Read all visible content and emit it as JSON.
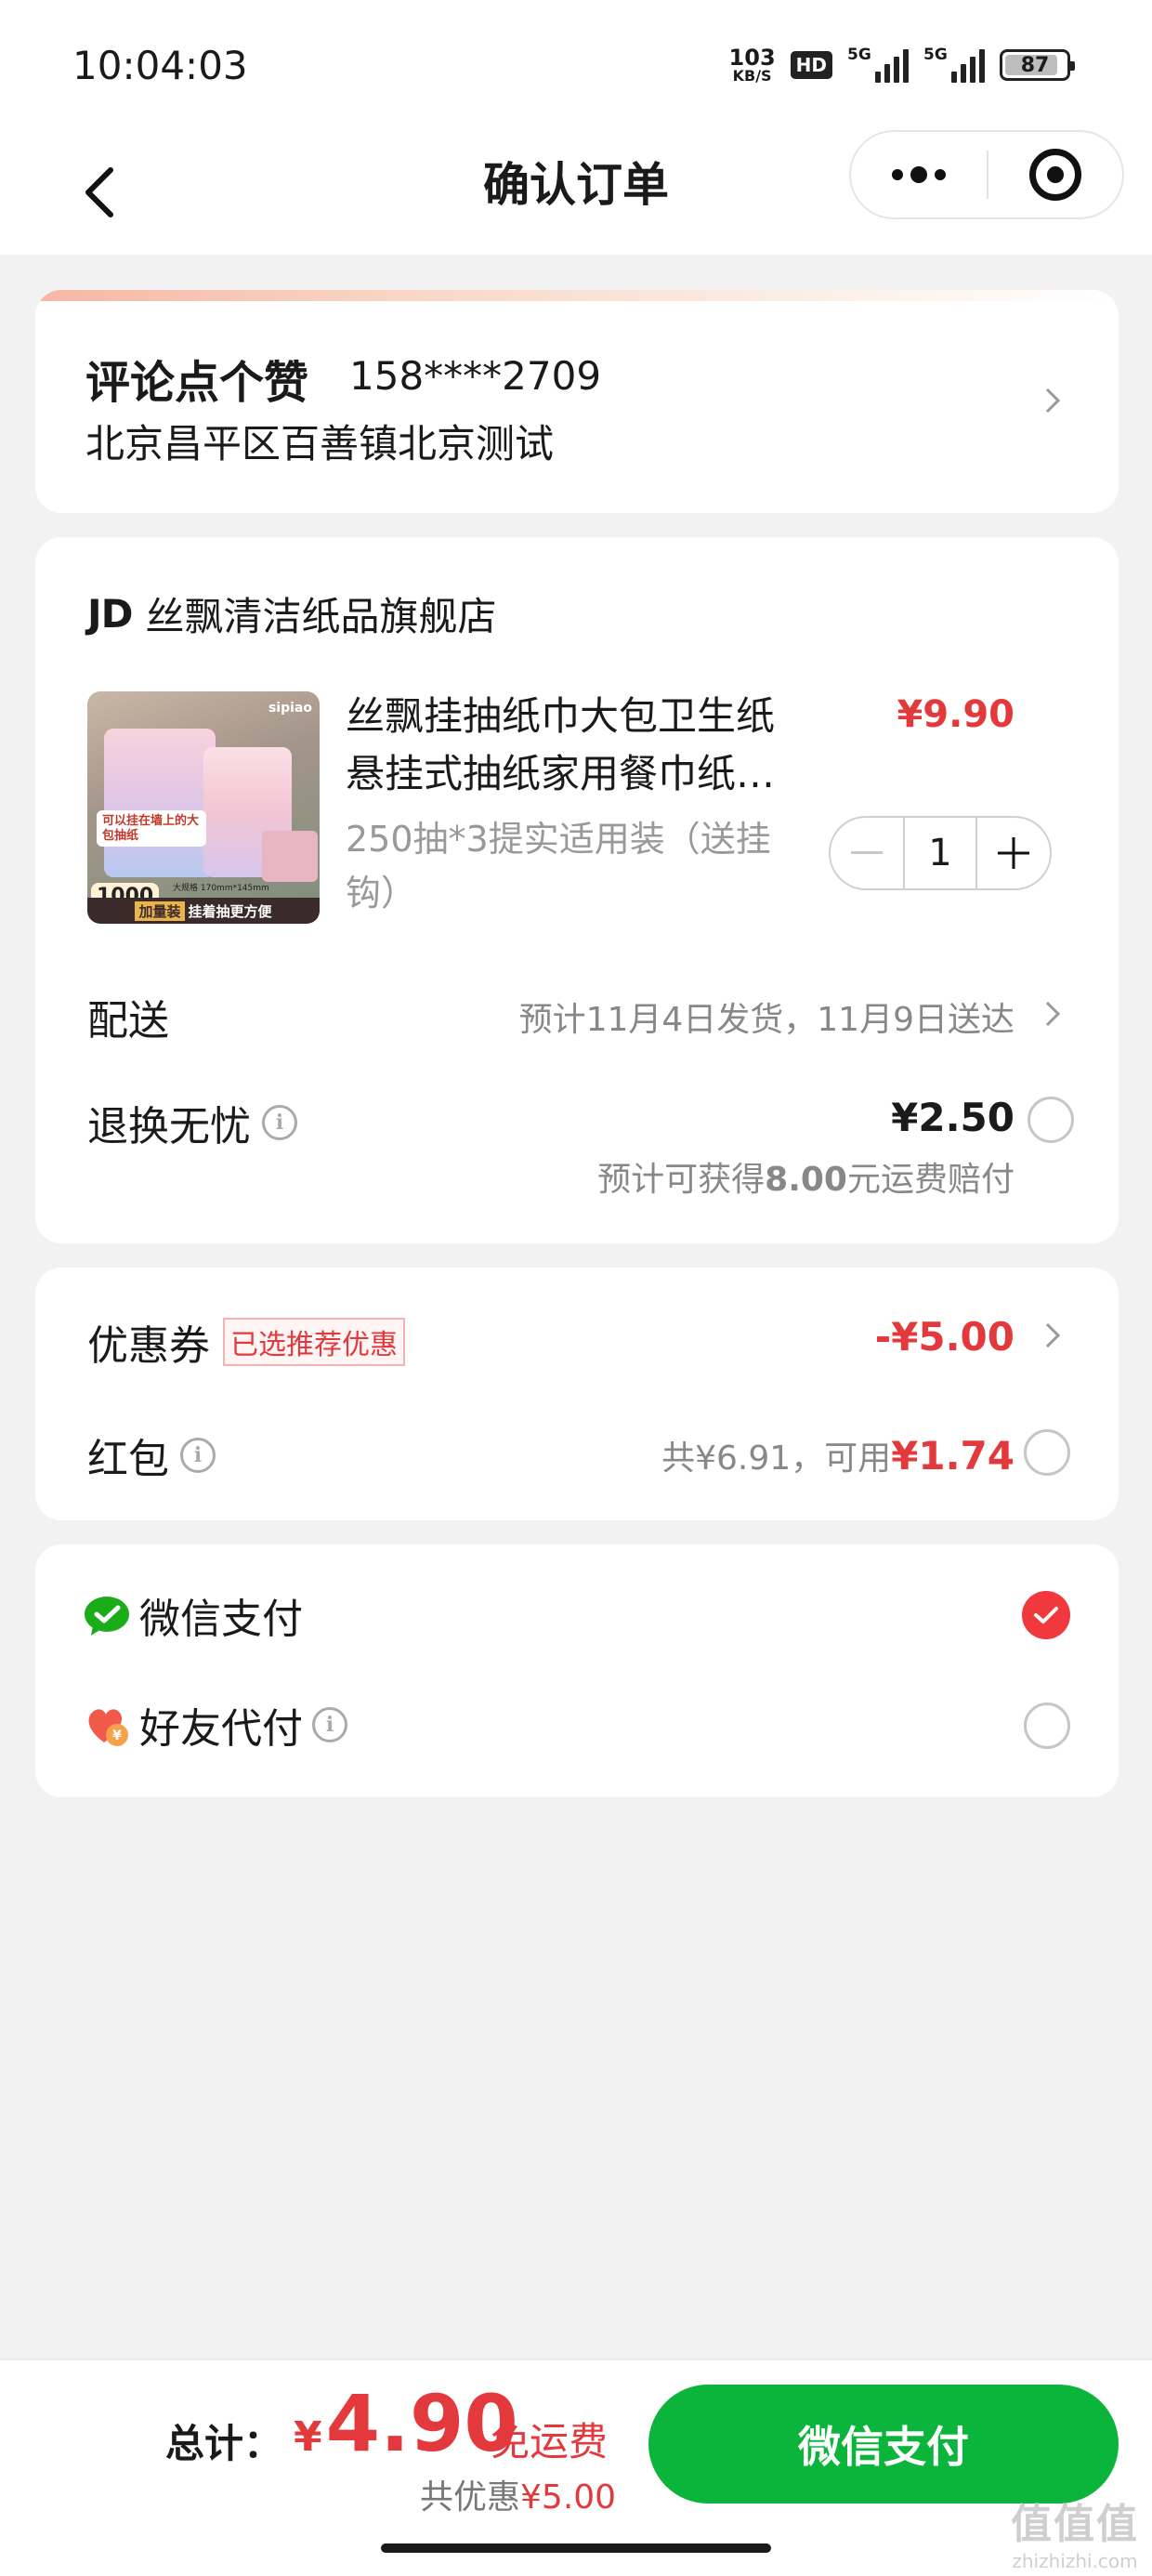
{
  "status_bar": {
    "time": "10:04:03",
    "net_speed_value": "103",
    "net_speed_unit": "KB/S",
    "hd_badge": "HD",
    "sim1_tag": "5G",
    "sim2_tag": "5G",
    "battery_level": "87",
    "battery_fraction": 0.87
  },
  "nav": {
    "title": "确认订单",
    "back_icon": "chevron-left-icon",
    "more_icon": "more-dots-icon",
    "close_icon": "target-circle-icon"
  },
  "address": {
    "name": "评论点个赞",
    "phone": "158****2709",
    "detail": "北京昌平区百善镇北京测试"
  },
  "store": {
    "logo": "JD",
    "name": "丝飘清洁纸品旗舰店"
  },
  "product": {
    "title_line1": "丝飘挂抽纸巾大包卫生纸",
    "title_line2": "悬挂式抽纸家用餐巾纸…",
    "price": "¥9.90",
    "spec_line1": "250抽*3提实适用装（送挂",
    "spec_line2": "钩）",
    "quantity": "1",
    "image": {
      "brand": "sipiao",
      "tagline": "可以挂在墙上的大包抽纸",
      "count": "1000",
      "spec": "大规格 170mm*145mm",
      "bottom_tag": "加量装",
      "bottom_text": "挂着抽更方便"
    }
  },
  "shipping": {
    "label": "配送",
    "value": "预计11月4日发货，11月9日送达"
  },
  "return_insurance": {
    "label": "退换无忧",
    "price": "¥2.50",
    "note_prefix": "预计可获得",
    "note_amount": "8.00",
    "note_suffix": "元运费赔付",
    "checked": false
  },
  "coupon": {
    "label": "优惠券",
    "tag": "已选推荐优惠",
    "amount": "-¥5.00"
  },
  "red_packet": {
    "label": "红包",
    "total": "共¥6.91，可用",
    "available": "¥1.74",
    "checked": false
  },
  "payment": {
    "wechat_label": "微信支付",
    "wechat_checked": true,
    "friend_label": "好友代付",
    "friend_checked": false
  },
  "footer": {
    "total_label": "总计：",
    "currency": "¥",
    "total_amount": "4.90",
    "free_shipping": "免运费",
    "discount_prefix": "共优惠",
    "discount_amount": "¥5.00",
    "pay_button": "微信支付"
  },
  "watermark": {
    "main": "值值值",
    "sub": "zhizhizhi.com"
  },
  "colors": {
    "accent_red": "#e4393c",
    "pay_green": "#0bb53b",
    "wechat_green": "#1aad19"
  }
}
